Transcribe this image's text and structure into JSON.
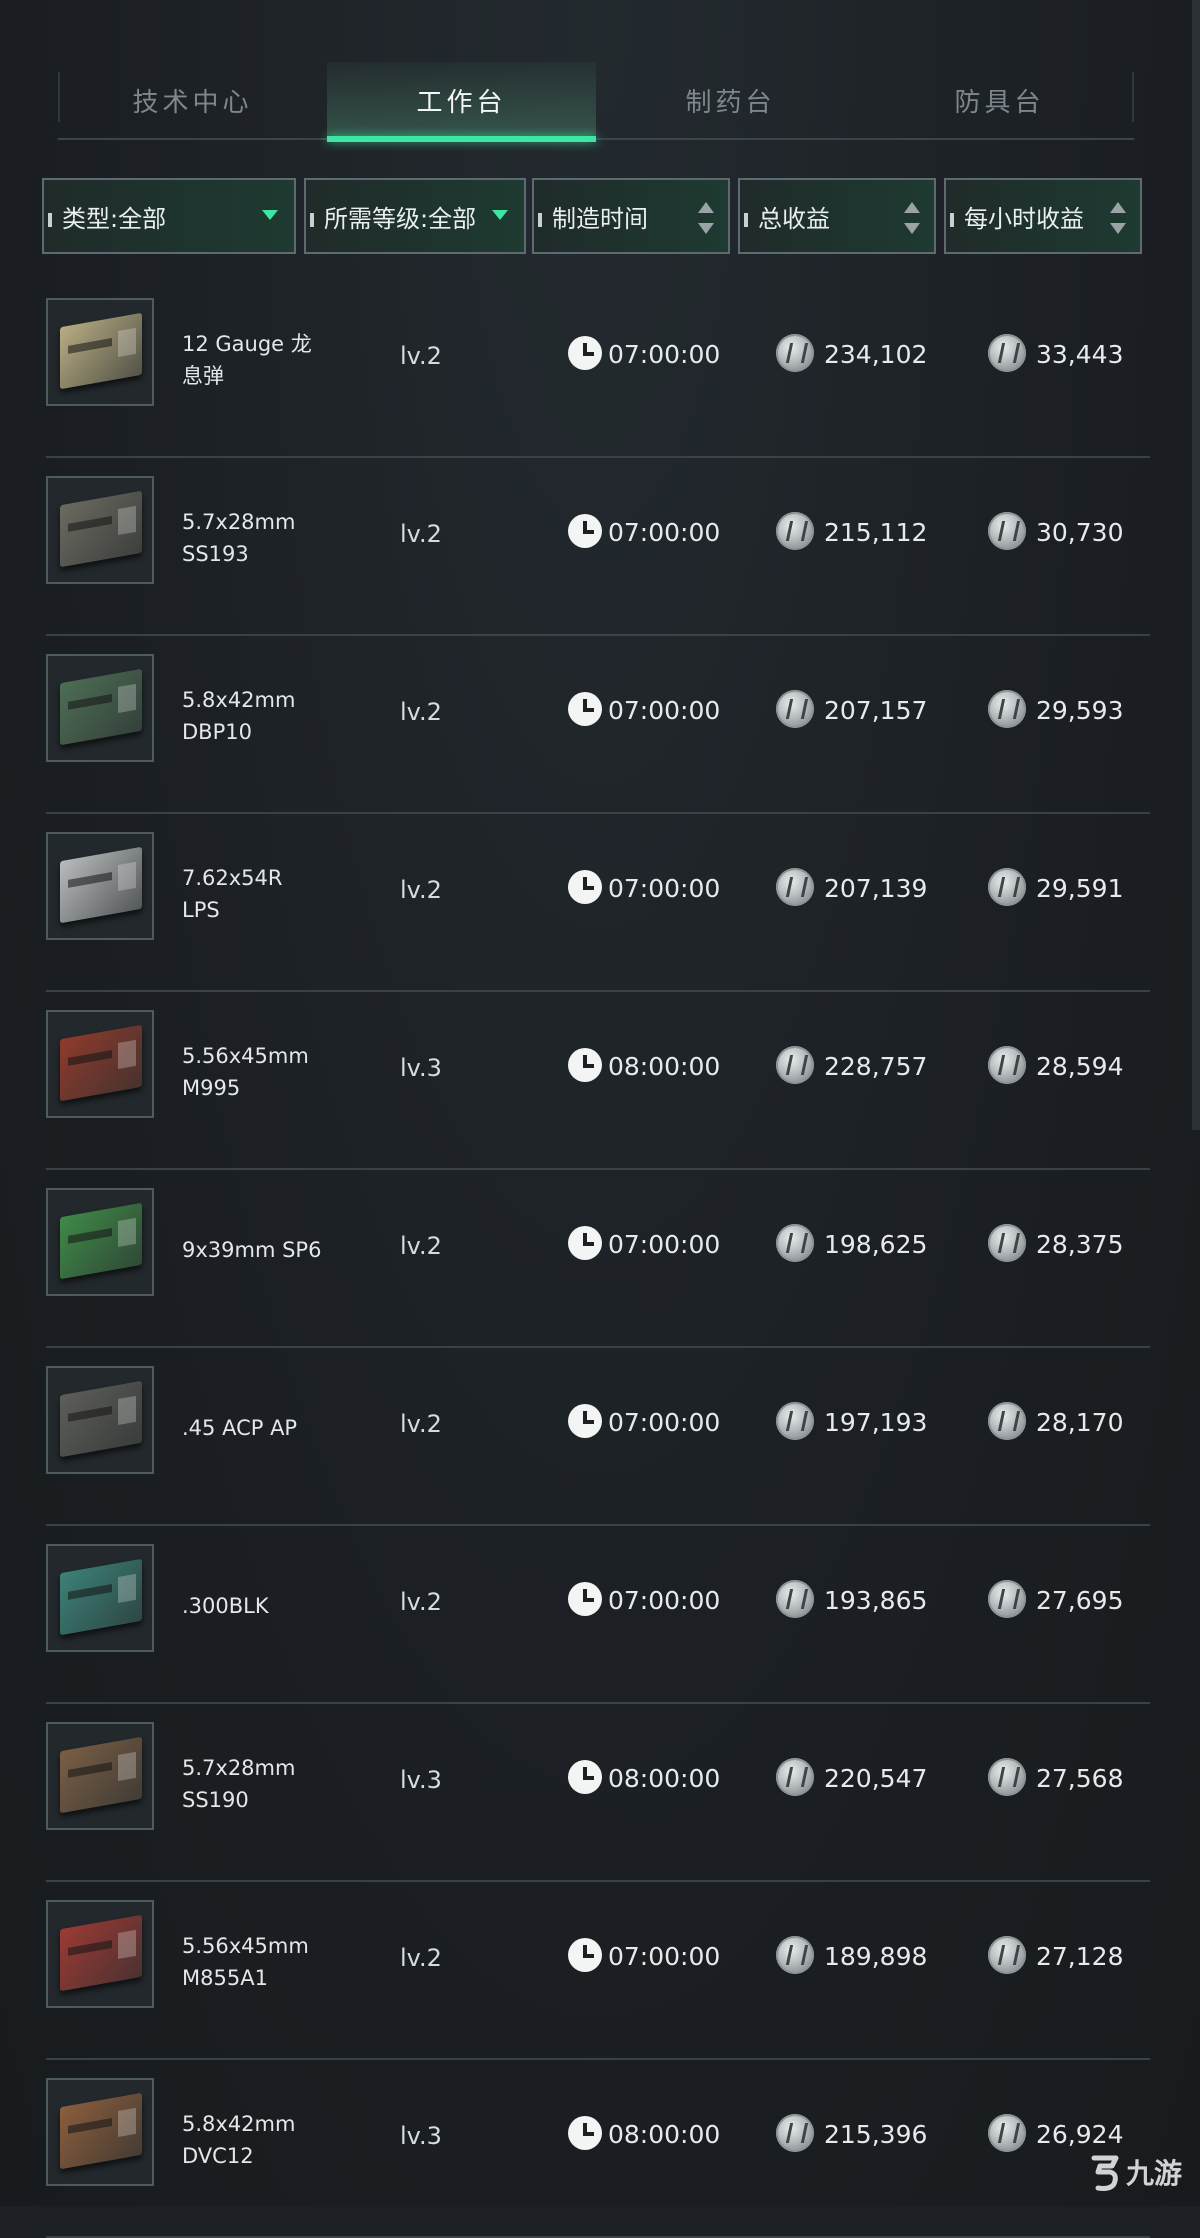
{
  "tabs": [
    {
      "label": "技术中心",
      "active": false
    },
    {
      "label": "工作台",
      "active": true
    },
    {
      "label": "制药台",
      "active": false
    },
    {
      "label": "防具台",
      "active": false
    }
  ],
  "filters": {
    "type": "类型:全部",
    "level": "所需等级:全部",
    "time": "制造时间",
    "total": "总收益",
    "hourly": "每小时收益"
  },
  "rows": [
    {
      "name": "12 Gauge 龙\n息弹",
      "level": "lv.2",
      "time": "07:00:00",
      "total": "234,102",
      "hourly": "33,443",
      "color": "#b8ad82"
    },
    {
      "name": "5.7x28mm\nSS193",
      "level": "lv.2",
      "time": "07:00:00",
      "total": "215,112",
      "hourly": "30,730",
      "color": "#6b6a60"
    },
    {
      "name": "5.8x42mm\nDBP10",
      "level": "lv.2",
      "time": "07:00:00",
      "total": "207,157",
      "hourly": "29,593",
      "color": "#4d6e54"
    },
    {
      "name": "7.62x54R\nLPS",
      "level": "lv.2",
      "time": "07:00:00",
      "total": "207,139",
      "hourly": "29,591",
      "color": "#b9bcbd"
    },
    {
      "name": "5.56x45mm\nM995",
      "level": "lv.3",
      "time": "08:00:00",
      "total": "228,757",
      "hourly": "28,594",
      "color": "#8e3b2c"
    },
    {
      "name": "9x39mm SP6",
      "level": "lv.2",
      "time": "07:00:00",
      "total": "198,625",
      "hourly": "28,375",
      "color": "#3f8a47"
    },
    {
      "name": ".45 ACP AP",
      "level": "lv.2",
      "time": "07:00:00",
      "total": "197,193",
      "hourly": "28,170",
      "color": "#5d5e58"
    },
    {
      "name": ".300BLK",
      "level": "lv.2",
      "time": "07:00:00",
      "total": "193,865",
      "hourly": "27,695",
      "color": "#3b8277"
    },
    {
      "name": "5.7x28mm\nSS190",
      "level": "lv.3",
      "time": "08:00:00",
      "total": "220,547",
      "hourly": "27,568",
      "color": "#7a5e44"
    },
    {
      "name": "5.56x45mm\nM855A1",
      "level": "lv.2",
      "time": "07:00:00",
      "total": "189,898",
      "hourly": "27,128",
      "color": "#9c3a34"
    },
    {
      "name": "5.8x42mm\nDVC12",
      "level": "lv.3",
      "time": "08:00:00",
      "total": "215,396",
      "hourly": "26,924",
      "color": "#8b5e3c"
    }
  ],
  "watermark": "九游"
}
